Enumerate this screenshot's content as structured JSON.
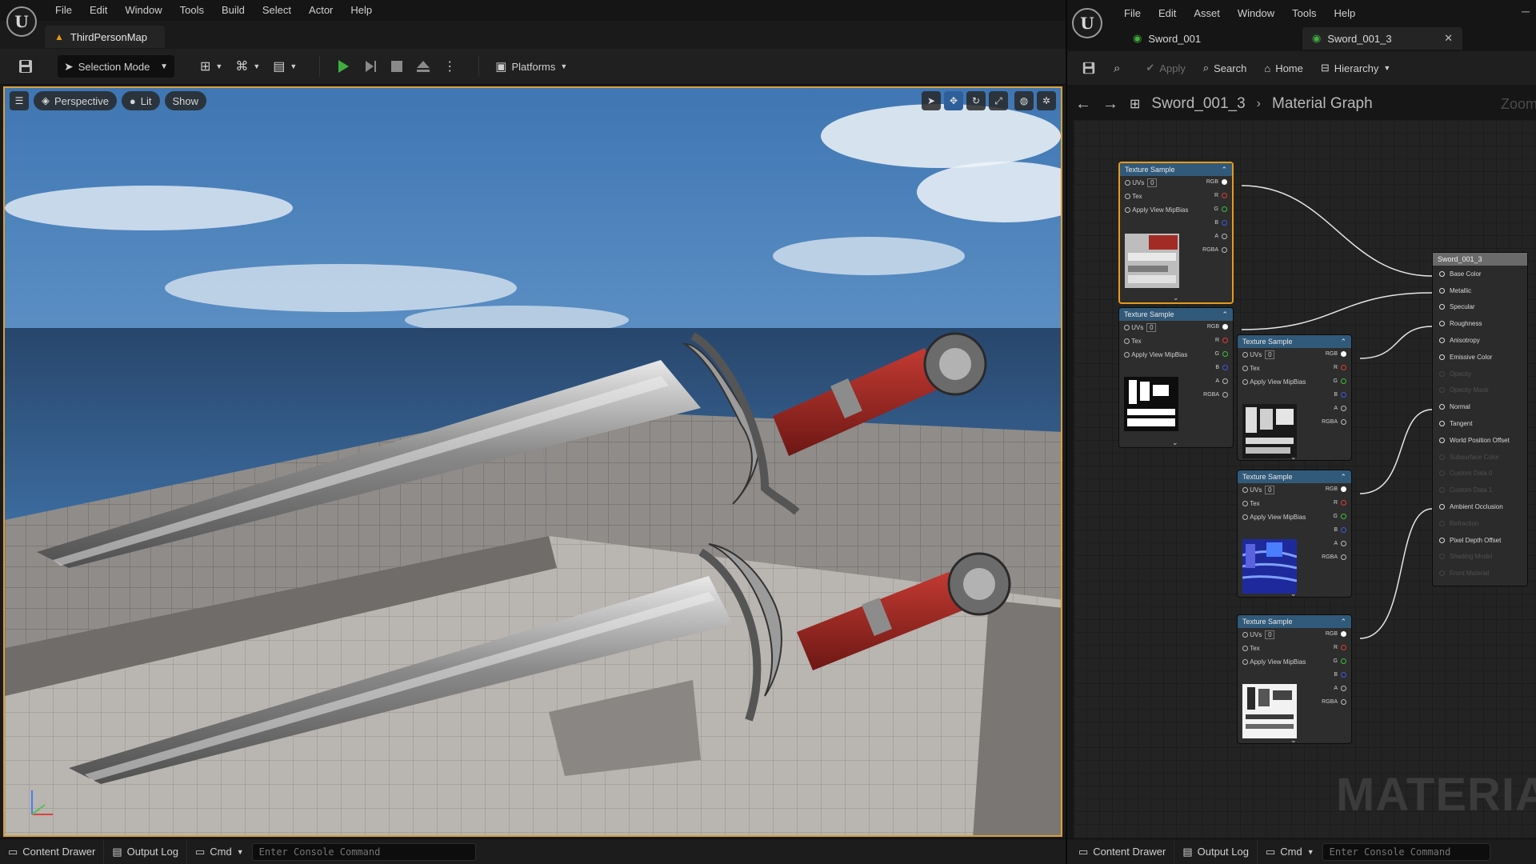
{
  "left": {
    "menu": [
      "File",
      "Edit",
      "Window",
      "Tools",
      "Build",
      "Select",
      "Actor",
      "Help"
    ],
    "level_tab": "ThirdPersonMap",
    "toolbar": {
      "selection_mode": "Selection Mode",
      "platforms": "Platforms"
    },
    "viewport": {
      "perspective": "Perspective",
      "lit": "Lit",
      "show": "Show"
    },
    "status": {
      "content_drawer": "Content Drawer",
      "output_log": "Output Log",
      "cmd": "Cmd",
      "console_placeholder": "Enter Console Command"
    }
  },
  "right": {
    "menu": [
      "File",
      "Edit",
      "Asset",
      "Window",
      "Tools",
      "Help"
    ],
    "tabs": [
      "Sword_001",
      "Sword_001_3"
    ],
    "toolbar": {
      "apply": "Apply",
      "search": "Search",
      "home": "Home",
      "hierarchy": "Hierarchy"
    },
    "breadcrumb": {
      "asset": "Sword_001_3",
      "graph": "Material Graph",
      "zoom": "Zoom"
    },
    "watermark": "MATERIAL",
    "node_title": "Texture Sample",
    "pins": {
      "uvs": "UVs",
      "uv_index": "0",
      "tex": "Tex",
      "mip": "Apply View MipBias"
    },
    "outputs": [
      "RGB",
      "R",
      "G",
      "B",
      "A",
      "RGBA"
    ],
    "result": {
      "title": "Sword_001_3",
      "inputs": [
        "Base Color",
        "Metallic",
        "Specular",
        "Roughness",
        "Anisotropy",
        "Emissive Color",
        "Opacity",
        "Opacity Mask",
        "Normal",
        "Tangent",
        "World Position Offset",
        "Subsurface Color",
        "Custom Data 0",
        "Custom Data 1",
        "Ambient Occlusion",
        "Refraction",
        "Pixel Depth Offset",
        "Shading Model",
        "Front Material"
      ],
      "dimmed": [
        6,
        7,
        11,
        12,
        13,
        15,
        17,
        18
      ]
    },
    "status": {
      "content_drawer": "Content Drawer",
      "output_log": "Output Log",
      "cmd": "Cmd",
      "console_placeholder": "Enter Console Command"
    }
  },
  "colors": {
    "selection_orange": "#e79a1c",
    "node_header_blue": "#315a7a",
    "play_green": "#3fae3f"
  }
}
